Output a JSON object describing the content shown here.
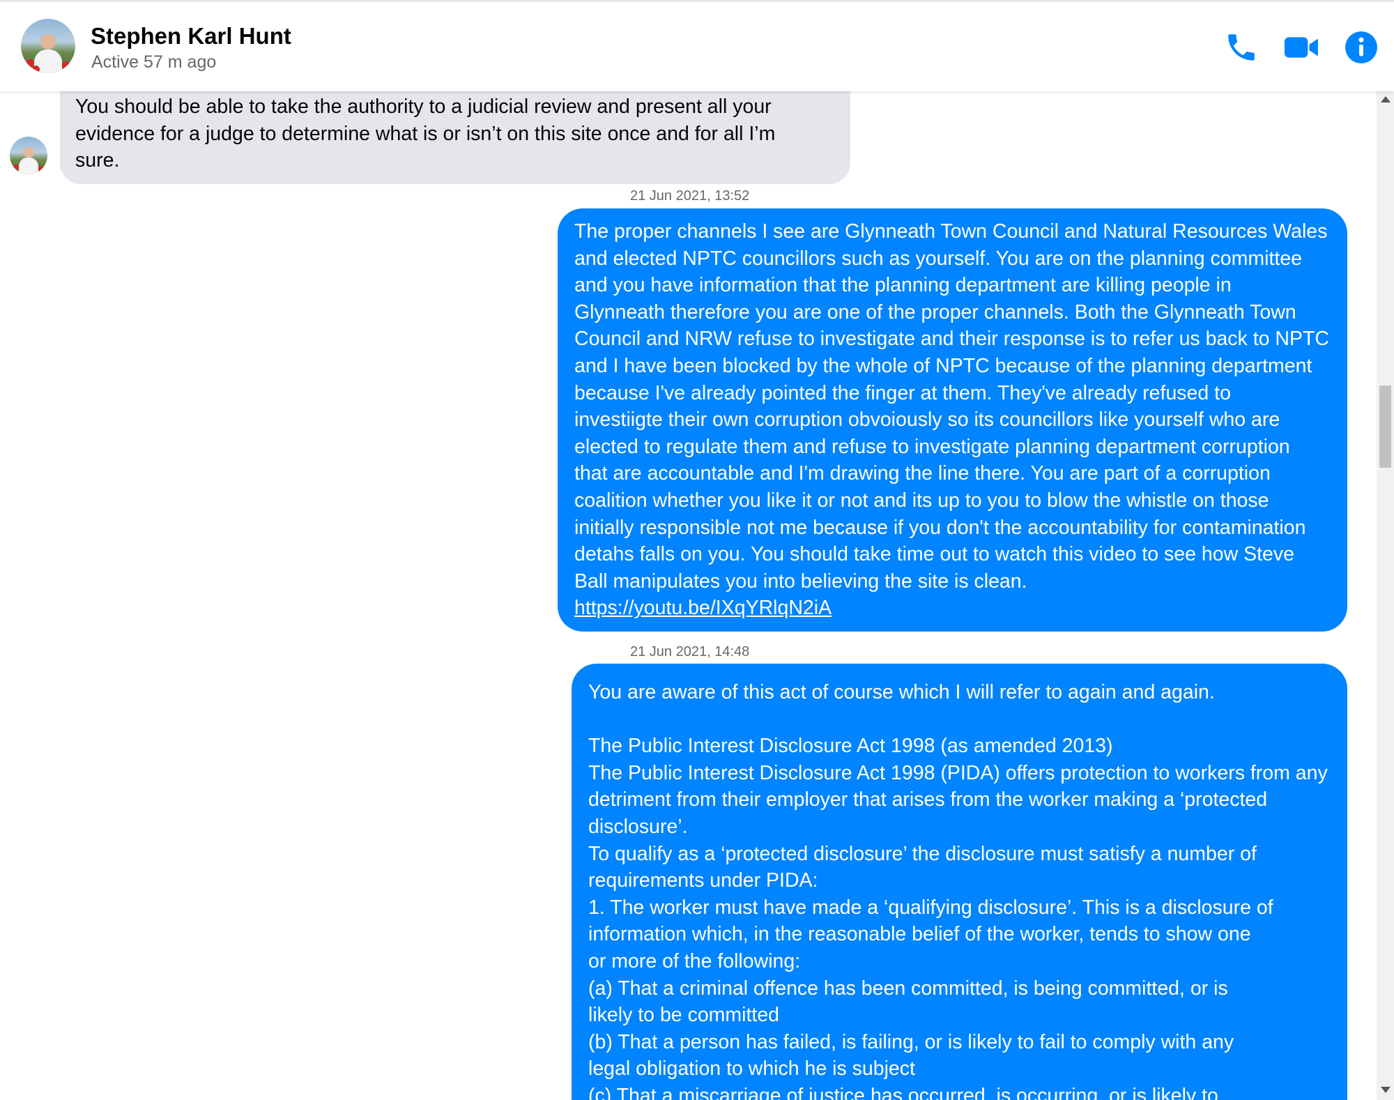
{
  "header": {
    "contact_name": "Stephen Karl Hunt",
    "status": "Active 57 m ago",
    "icons": [
      "phone-icon",
      "video-camera-icon",
      "info-icon"
    ],
    "accent_color": "#0084ff"
  },
  "messages": [
    {
      "direction": "incoming",
      "text": "You should be able to take the authority to a judicial review and present all your\nevidence for a judge to determine what is or isn’t on this site once and for all I’m\nsure."
    },
    {
      "direction": "outgoing",
      "timestamp": "21 Jun 2021, 13:52",
      "text": "The proper channels I see are Glynneath Town Council and Natural Resources Wales\nand elected NPTC councillors such as yourself. You are on the planning committee\nand you have information that the planning department are killing people in\nGlynneath therefore you are one of the proper channels. Both the Glynneath Town\nCouncil and NRW refuse to investigate and their response is to refer us back to NPTC\nand I have been blocked by the whole of NPTC because of the planning department\nbecause I've already pointed the finger at them. They've already refused to\ninvestiigte their own corruption obvoiously so its councillors like yourself who are\nelected to regulate them and refuse to investigate planning department corruption\nthat are accountable and I'm drawing the line there. You are part of a corruption\ncoalition whether you like it or not and its up to you to blow the whistle on those\ninitially responsible not me because if you don't the accountability for contamination\ndetahs falls on you. You should take time out to watch this video to see how Steve\nBall manipulates you into believing the site is clean.",
      "link": "https://youtu.be/IXqYRlqN2iA"
    },
    {
      "direction": "outgoing",
      "timestamp": "21 Jun 2021, 14:48",
      "text": "You are aware of this act of course which I will refer to again and again.\n\nThe Public Interest Disclosure Act 1998 (as amended 2013)\nThe Public Interest Disclosure Act 1998 (PIDA) offers protection to workers from any\ndetriment from their employer that arises from the worker making a ‘protected\ndisclosure’.\nTo qualify as a ‘protected disclosure’ the disclosure must satisfy a number of\nrequirements under PIDA:\n1. The worker must have made a ‘qualifying disclosure’. This is a disclosure of\ninformation which, in the reasonable belief of the worker, tends to show one\nor more of the following:\n(a) That a criminal offence has been committed, is being committed, or is\nlikely to be committed\n(b) That a person has failed, is failing, or is likely to fail to comply with any\nlegal obligation to which he is subject\n(c) That a miscarriage of justice has occurred, is occurring, or is likely to"
    }
  ]
}
